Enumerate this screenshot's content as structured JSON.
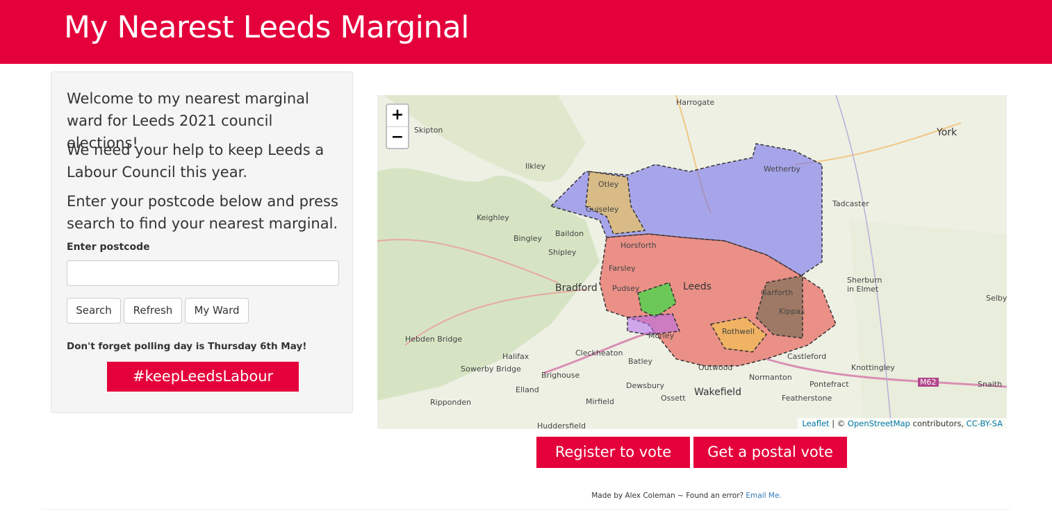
{
  "header": {
    "title": "My Nearest Leeds Marginal"
  },
  "panel": {
    "intro": "Welcome to my nearest marginal ward for Leeds 2021 council elections!",
    "help": "We need your help to keep Leeds a Labour Council this year.",
    "instructions": "Enter your postcode below and press search to find your nearest marginal.",
    "postcode_label": "Enter postcode",
    "postcode_value": "",
    "buttons": {
      "search": "Search",
      "refresh": "Refresh",
      "my_ward": "My Ward"
    },
    "polling": "Don't forget polling day is Thursday 6th May!",
    "hashtag": "#keepLeedsLabour"
  },
  "map": {
    "zoom_in": "+",
    "zoom_out": "−",
    "labels": [
      "Harrogate",
      "Skipton",
      "York",
      "Ilkley",
      "Wetherby",
      "Otley",
      "Keighley",
      "Guiseley",
      "Tadcaster",
      "Baildon",
      "Bingley",
      "Shipley",
      "Horsforth",
      "Farsley",
      "Bradford",
      "Pudsey",
      "Leeds",
      "Sherburn in Elmet",
      "Garforth",
      "Selby",
      "Kippax",
      "Hebden Bridge",
      "Morley",
      "Rothwell",
      "Halifax",
      "Cleckheaton",
      "Batley",
      "Castleford",
      "Sowerby Bridge",
      "Brighouse",
      "Outwood",
      "Knottingley",
      "Normanton",
      "Elland",
      "Pontefract",
      "Dewsbury",
      "Wakefield",
      "Ossett",
      "Featherstone",
      "Mirfield",
      "Ripponden",
      "Huddersfield",
      "Snaith",
      "M62"
    ],
    "attribution": {
      "leaflet": "Leaflet",
      "sep": " | © ",
      "osm": "OpenStreetMap",
      "contrib": " contributors, ",
      "license": "CC-BY-SA"
    }
  },
  "cta": {
    "register": "Register to vote",
    "postal": "Get a postal vote"
  },
  "footer": {
    "text": "Made by Alex Coleman ~ Found an error? ",
    "link": "Email Me."
  },
  "colors": {
    "brand": "#e4003b",
    "labour": "#e8504a",
    "conservative": "#6e68ef",
    "libdem": "#f3c650",
    "green": "#4cd64a",
    "independent": "#7c5c5c"
  }
}
